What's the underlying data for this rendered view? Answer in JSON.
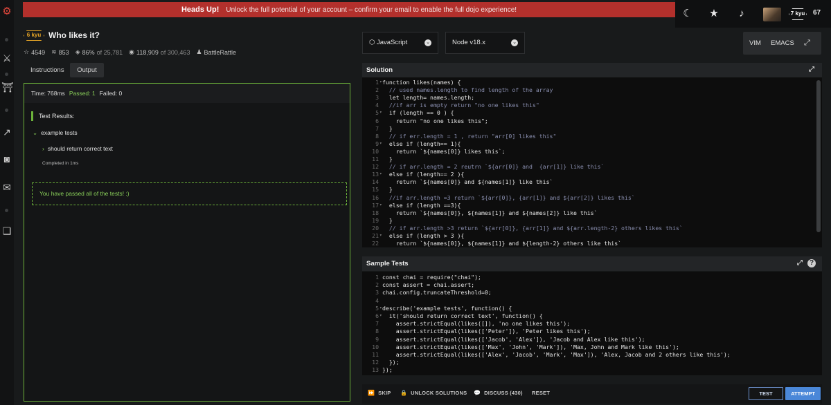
{
  "banner": {
    "heading": "Heads Up!",
    "message": "Unlock the full potential of your account – confirm your email to enable the full dojo experience!"
  },
  "user": {
    "rank": "7 kyu",
    "honor": "67"
  },
  "kata": {
    "rank": "6 kyu",
    "title": "Who likes it?",
    "stars": "4549",
    "collections": "853",
    "satisfaction": "86%",
    "satisfaction_of": "of 25,781",
    "completed": "118,909",
    "completed_of": "of 300,463",
    "author": "BattleRattle"
  },
  "tabs": [
    "Instructions",
    "Output"
  ],
  "output": {
    "time": "Time: 768ms",
    "passed": "Passed: 1",
    "failed": "Failed: 0",
    "results_heading": "Test Results:",
    "group": "example tests",
    "test": "should return correct text",
    "completed": "Completed in 1ms",
    "success": "You have passed all of the tests! :)"
  },
  "language": "JavaScript",
  "runtime": "Node v18.x",
  "keymap": [
    "VIM",
    "EMACS"
  ],
  "solution": {
    "title": "Solution",
    "lines": [
      "function likes(names) {",
      "  // used names.length to find length of the array",
      "  let length= names.length;",
      "  //if arr is empty return \"no one likes this\"",
      "  if (length == 0 ) {",
      "    return \"no one likes this\";",
      "  }",
      "  // if err.length = 1 , return \"arr[0] likes this\"",
      "  else if (length== 1){",
      "    return `${names[0]} likes this`;",
      "  }",
      "  // if arr.length = 2 reutrn `${arr[0]} and  {arr[1]} like this`",
      "  else if (length== 2 ){",
      "    return `${names[0]} and ${names[1]} like this`",
      "  }",
      "  //if arr.length =3 return `${arr[0]}, {arr[1]} and ${arr[2]} likes this`",
      "  else if (length ==3){",
      "    return `${names[0]}, ${names[1]} and ${names[2]} like this`",
      "  }",
      "  // if arr.length >3 return `${arr[0]}, {arr[1]} and ${arr.length-2} others likes this`",
      "  else if (length > 3 ){",
      "    return `${names[0]}, ${names[1]} and ${length-2} others like this`"
    ]
  },
  "sample_tests": {
    "title": "Sample Tests",
    "lines": [
      "const chai = require(\"chai\");",
      "const assert = chai.assert;",
      "chai.config.truncateThreshold=0;",
      "",
      "describe('example tests', function() {",
      "  it('should return correct text', function() {",
      "    assert.strictEqual(likes([]), 'no one likes this');",
      "    assert.strictEqual(likes(['Peter']), 'Peter likes this');",
      "    assert.strictEqual(likes(['Jacob', 'Alex']), 'Jacob and Alex like this');",
      "    assert.strictEqual(likes(['Max', 'John', 'Mark']), 'Max, John and Mark like this');",
      "    assert.strictEqual(likes(['Alex', 'Jacob', 'Mark', 'Max']), 'Alex, Jacob and 2 others like this');",
      "  });",
      "});"
    ]
  },
  "actions": {
    "skip": "SKIP",
    "unlock": "UNLOCK SOLUTIONS",
    "discuss": "DISCUSS (430)",
    "reset": "RESET",
    "test": "TEST",
    "attempt": "ATTEMPT"
  }
}
